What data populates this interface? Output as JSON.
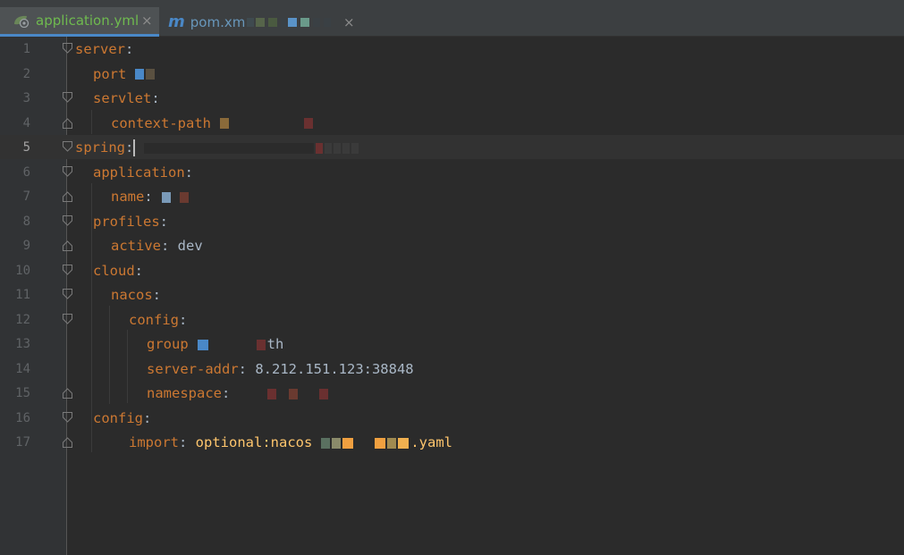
{
  "tabs": [
    {
      "label": "application.yml",
      "icon": "spring-leaf-icon",
      "active": true
    },
    {
      "label": "pom.xm",
      "icon": "maven-icon",
      "active": false
    }
  ],
  "tab_close_glyph": "×",
  "maven_glyph": "m",
  "lines": [
    {
      "n": "1",
      "indent": 0,
      "key": "server",
      "sep": ":",
      "value": "",
      "fold": "open"
    },
    {
      "n": "2",
      "indent": 1,
      "key": "port",
      "sep": "",
      "value": "",
      "fold": ""
    },
    {
      "n": "3",
      "indent": 1,
      "key": "servlet",
      "sep": ":",
      "value": "",
      "fold": "open"
    },
    {
      "n": "4",
      "indent": 2,
      "key": "context-path",
      "sep": "",
      "value": "",
      "fold": "close"
    },
    {
      "n": "5",
      "indent": 0,
      "key": "spring",
      "sep": ":",
      "value": "",
      "fold": "open",
      "current": true
    },
    {
      "n": "6",
      "indent": 1,
      "key": "application",
      "sep": ":",
      "value": "",
      "fold": "open"
    },
    {
      "n": "7",
      "indent": 2,
      "key": "name",
      "sep": ":",
      "value": "",
      "fold": "close"
    },
    {
      "n": "8",
      "indent": 1,
      "key": "profiles",
      "sep": ":",
      "value": "",
      "fold": "open"
    },
    {
      "n": "9",
      "indent": 2,
      "key": "active",
      "sep": ":",
      "value": " dev",
      "fold": "close"
    },
    {
      "n": "10",
      "indent": 1,
      "key": "cloud",
      "sep": ":",
      "value": "",
      "fold": "open"
    },
    {
      "n": "11",
      "indent": 2,
      "key": "nacos",
      "sep": ":",
      "value": "",
      "fold": "open"
    },
    {
      "n": "12",
      "indent": 3,
      "key": "config",
      "sep": ":",
      "value": "",
      "fold": "open"
    },
    {
      "n": "13",
      "indent": 4,
      "key": "group",
      "sep": "",
      "value": "th",
      "fold": ""
    },
    {
      "n": "14",
      "indent": 4,
      "key": "server-addr",
      "sep": ":",
      "value": " 8.212.151.123:38848",
      "fold": ""
    },
    {
      "n": "15",
      "indent": 4,
      "key": "namespace",
      "sep": ":",
      "value": "",
      "fold": "close"
    },
    {
      "n": "16",
      "indent": 1,
      "key": "config",
      "sep": ":",
      "value": "",
      "fold": "open"
    },
    {
      "n": "17",
      "indent": 3,
      "key": "import",
      "sep": ":",
      "value": " optional:nacos",
      "value_tail": ".yaml",
      "fold": "close"
    }
  ],
  "colors": {
    "background": "#2b2b2b",
    "gutter": "#313335",
    "key": "#cc7832",
    "value": "#a9b7c6",
    "string": "#ffc66d",
    "active_tab_text": "#6fba4f",
    "tab_text": "#6897bb",
    "tab_underline": "#4a88c7"
  }
}
